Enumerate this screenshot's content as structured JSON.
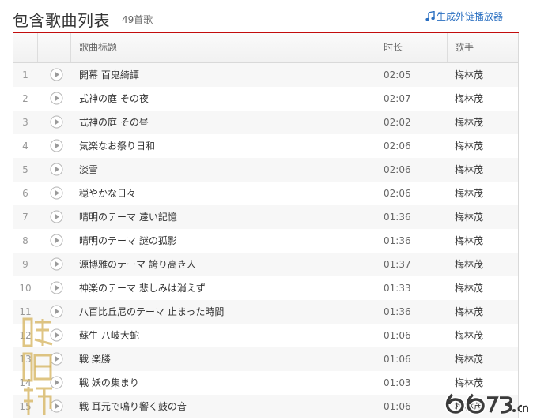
{
  "header": {
    "title": "包含歌曲列表",
    "count": "49首歌",
    "gen_link": "生成外链播放器"
  },
  "table": {
    "columns": {
      "title": "歌曲标题",
      "duration": "时长",
      "artist": "歌手"
    },
    "rows": [
      {
        "num": "1",
        "title": "開幕 百鬼綺譚",
        "duration": "02:05",
        "artist": "梅林茂"
      },
      {
        "num": "2",
        "title": "式神の庭 その夜",
        "duration": "02:07",
        "artist": "梅林茂"
      },
      {
        "num": "3",
        "title": "式神の庭 その昼",
        "duration": "02:02",
        "artist": "梅林茂"
      },
      {
        "num": "4",
        "title": "気楽なお祭り日和",
        "duration": "02:06",
        "artist": "梅林茂"
      },
      {
        "num": "5",
        "title": "淡雪",
        "duration": "02:06",
        "artist": "梅林茂"
      },
      {
        "num": "6",
        "title": "穏やかな日々",
        "duration": "02:06",
        "artist": "梅林茂"
      },
      {
        "num": "7",
        "title": "晴明のテーマ 遠い記憶",
        "duration": "01:36",
        "artist": "梅林茂"
      },
      {
        "num": "8",
        "title": "晴明のテーマ 謎の孤影",
        "duration": "01:36",
        "artist": "梅林茂"
      },
      {
        "num": "9",
        "title": "源博雅のテーマ 誇り高き人",
        "duration": "01:37",
        "artist": "梅林茂"
      },
      {
        "num": "10",
        "title": "神楽のテーマ 悲しみは消えず",
        "duration": "01:33",
        "artist": "梅林茂"
      },
      {
        "num": "11",
        "title": "八百比丘尼のテーマ 止まった時間",
        "duration": "01:36",
        "artist": "梅林茂"
      },
      {
        "num": "12",
        "title": "蘇生 八岐大蛇",
        "duration": "01:06",
        "artist": "梅林茂"
      },
      {
        "num": "13",
        "title": "戦 楽勝",
        "duration": "01:06",
        "artist": "梅林茂"
      },
      {
        "num": "14",
        "title": "戦 妖の集まり",
        "duration": "01:03",
        "artist": "梅林茂"
      },
      {
        "num": "15",
        "title": "戦 耳元で鳴り響く鼓の音",
        "duration": "01:06",
        "artist": "梅林茂"
      }
    ]
  },
  "icons": {
    "play": "play-circle-icon",
    "note": "music-note-icon"
  },
  "colors": {
    "accent": "#c20c0c",
    "link": "#2a6fc1",
    "stripe": "#f7f7f7"
  },
  "watermarks": {
    "left": "陰陽師",
    "right": "6673.cn"
  }
}
